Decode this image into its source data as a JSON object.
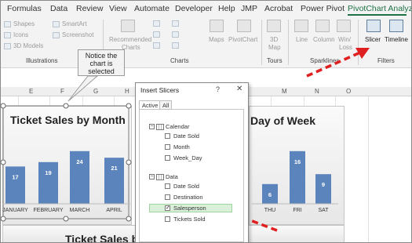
{
  "ribbon_tabs": [
    "Formulas",
    "Data",
    "Review",
    "View",
    "Automate",
    "Developer",
    "Help",
    "JMP",
    "Acrobat",
    "Power Pivot",
    "PivotChart Analyze"
  ],
  "active_tab": "PivotChart Analyze",
  "ribbon": {
    "illustrations": {
      "shapes": "Shapes",
      "icons": "Icons",
      "models": "3D Models",
      "smartart": "SmartArt",
      "screenshot": "Screenshot",
      "label": "Illustrations"
    },
    "charts": {
      "recommended": "Recommended",
      "recommended2": "Charts",
      "maps": "Maps",
      "pivotchart": "PivotChart",
      "label": "Charts"
    },
    "tours": {
      "map3d": "3D",
      "map3d2": "Map",
      "label": "Tours"
    },
    "sparklines": {
      "line": "Line",
      "column": "Column",
      "winloss": "Win/",
      "winloss2": "Loss",
      "label": "Sparklines"
    },
    "filters": {
      "slicer": "Slicer",
      "timeline": "Timeline",
      "label": "Filters"
    }
  },
  "column_headers": [
    "E",
    "F",
    "G",
    "H",
    "M",
    "N",
    "O"
  ],
  "callout": {
    "line1": "Notice the",
    "line2": "chart is",
    "line3": "selected"
  },
  "chart1": {
    "title": "Ticket Sales by Month"
  },
  "chart2": {
    "title": "Day of Week"
  },
  "chart3": {
    "title": "Ticket Sales by"
  },
  "dialog": {
    "title": "Insert Slicers",
    "help": "?",
    "close": "✕",
    "tabs": [
      "Active",
      "All"
    ],
    "groups": [
      {
        "name": "Calendar",
        "fields": [
          {
            "label": "Date Sold",
            "checked": false
          },
          {
            "label": "Month",
            "checked": false
          },
          {
            "label": "Week_Day",
            "checked": false
          }
        ]
      },
      {
        "name": "Data",
        "fields": [
          {
            "label": "Date Sold",
            "checked": false
          },
          {
            "label": "Destination",
            "checked": false
          },
          {
            "label": "Salesperson",
            "checked": true
          },
          {
            "label": "Tickets Sold",
            "checked": false
          }
        ]
      }
    ]
  },
  "chart_data": [
    {
      "type": "bar",
      "title": "Ticket Sales by Month",
      "categories": [
        "JANUARY",
        "FEBRUARY",
        "MARCH",
        "APRIL"
      ],
      "values": [
        17,
        19,
        24,
        21
      ],
      "ylim": [
        0,
        30
      ],
      "color": "#5b84bd"
    },
    {
      "type": "bar",
      "title": "Day of Week",
      "categories": [
        "THU",
        "FRI",
        "SAT"
      ],
      "values": [
        6,
        16,
        9
      ],
      "ylim": [
        0,
        20
      ],
      "color": "#5b84bd"
    }
  ],
  "colors": {
    "accent": "#1e7145",
    "bar": "#5b84bd",
    "arrow": "#e02020",
    "selected_row": "#daf0da"
  }
}
